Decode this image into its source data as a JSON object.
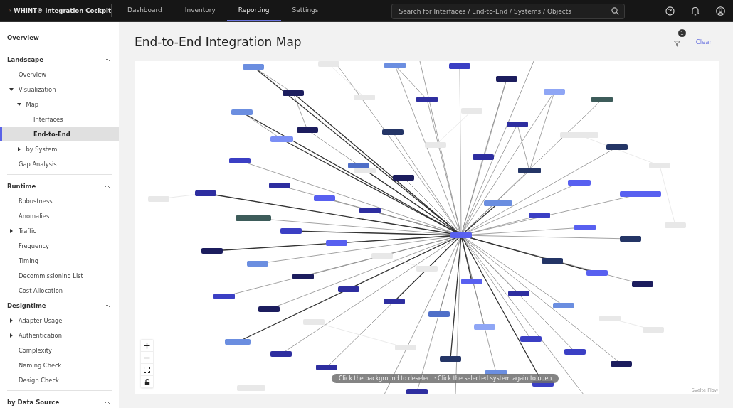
{
  "app": {
    "brand": "WHINT® Integration Cockpit"
  },
  "nav": [
    {
      "label": "Dashboard",
      "selected": false
    },
    {
      "label": "Inventory",
      "selected": false
    },
    {
      "label": "Reporting",
      "selected": true
    },
    {
      "label": "Settings",
      "selected": false
    }
  ],
  "search": {
    "placeholder": "Search for Interfaces / End-to-End / Systems / Objects"
  },
  "sidebar": {
    "sections": [
      {
        "title": "Overview",
        "divider": false
      },
      {
        "title": "Landscape",
        "divider": true,
        "expanded": true,
        "items": [
          {
            "label": "Overview",
            "selected": false
          },
          {
            "label": "Visualization",
            "selected": false,
            "expanded": true,
            "children": [
              {
                "label": "Map",
                "selected": false,
                "expanded": true,
                "children": [
                  {
                    "label": "Interfaces",
                    "selected": false
                  },
                  {
                    "label": "End-to-End",
                    "selected": true
                  }
                ]
              },
              {
                "label": "by System",
                "selected": false,
                "expanded": false
              }
            ]
          },
          {
            "label": "Gap Analysis",
            "selected": false
          }
        ]
      },
      {
        "title": "Runtime",
        "divider": true,
        "expanded": true,
        "items": [
          {
            "label": "Robustness",
            "selected": false
          },
          {
            "label": "Anomalies",
            "selected": false
          },
          {
            "label": "Traffic",
            "selected": false,
            "expanded": false
          },
          {
            "label": "Frequency",
            "selected": false
          },
          {
            "label": "Timing",
            "selected": false
          },
          {
            "label": "Decommissioning List",
            "selected": false
          },
          {
            "label": "Cost Allocation",
            "selected": false
          }
        ]
      },
      {
        "title": "Designtime",
        "divider": false,
        "expanded": true,
        "items": [
          {
            "label": "Adapter Usage",
            "selected": false,
            "expanded": false
          },
          {
            "label": "Authentication",
            "selected": false,
            "expanded": false
          },
          {
            "label": "Complexity",
            "selected": false
          },
          {
            "label": "Naming Check",
            "selected": false
          },
          {
            "label": "Design Check",
            "selected": false
          }
        ]
      },
      {
        "title": "by Data Source",
        "divider": true,
        "expanded": true
      }
    ]
  },
  "page": {
    "title": "End-to-End Integration Map",
    "filter_count": "1",
    "clear": "Clear"
  },
  "map": {
    "hint": "Click the background to deselect · Click the selected system again to open",
    "attribution": "Svelte Flow"
  }
}
